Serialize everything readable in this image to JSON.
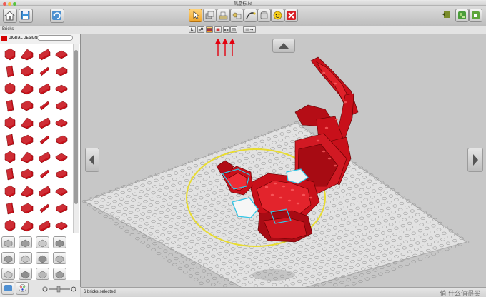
{
  "window": {
    "title": "凤凰标.lxf"
  },
  "toolbar": {
    "left_icons": [
      "home-icon",
      "save-icon",
      "undo-icon"
    ],
    "center_tools": [
      {
        "name": "select-tool",
        "icon": "cursor-icon",
        "active": true
      },
      {
        "name": "clone-tool",
        "icon": "clone-icon",
        "active": false
      },
      {
        "name": "hinge-tool",
        "icon": "hinge-icon",
        "active": false
      },
      {
        "name": "hinge-align-tool",
        "icon": "hinge-align-icon",
        "active": false
      },
      {
        "name": "flex-tool",
        "icon": "flex-icon",
        "active": false
      },
      {
        "name": "paint-tool",
        "icon": "paint-bucket-icon",
        "active": false
      },
      {
        "name": "hide-tool",
        "icon": "hide-icon",
        "active": false
      },
      {
        "name": "delete-tool",
        "icon": "delete-icon",
        "active": false
      }
    ],
    "right_icons": [
      "build-mode-icon",
      "view-mode-icon",
      "instructions-icon"
    ]
  },
  "subbar": {
    "label": "Bricks",
    "selection_modes": [
      "single-select-icon",
      "multi-select-icon",
      "connected-select-icon",
      "same-color-select-icon",
      "same-shape-select-icon"
    ],
    "active_mode_index": 2,
    "extra_button": "invert-selection-icon"
  },
  "left_panel": {
    "brand_name": "DIGITAL DESIGNER",
    "search_placeholder": "",
    "accent_color": "#cc0000"
  },
  "status": {
    "text": "6 bricks selected",
    "watermark": "值 什么值得买"
  },
  "colors": {
    "brick_red": "#c8101a",
    "selection_ring": "#e8dc30",
    "selection_outline": "#33c6e6",
    "baseplate": "#e2e2e2",
    "viewport_bg": "#c7c7c7",
    "indicator_arrows": "#e3000f"
  }
}
